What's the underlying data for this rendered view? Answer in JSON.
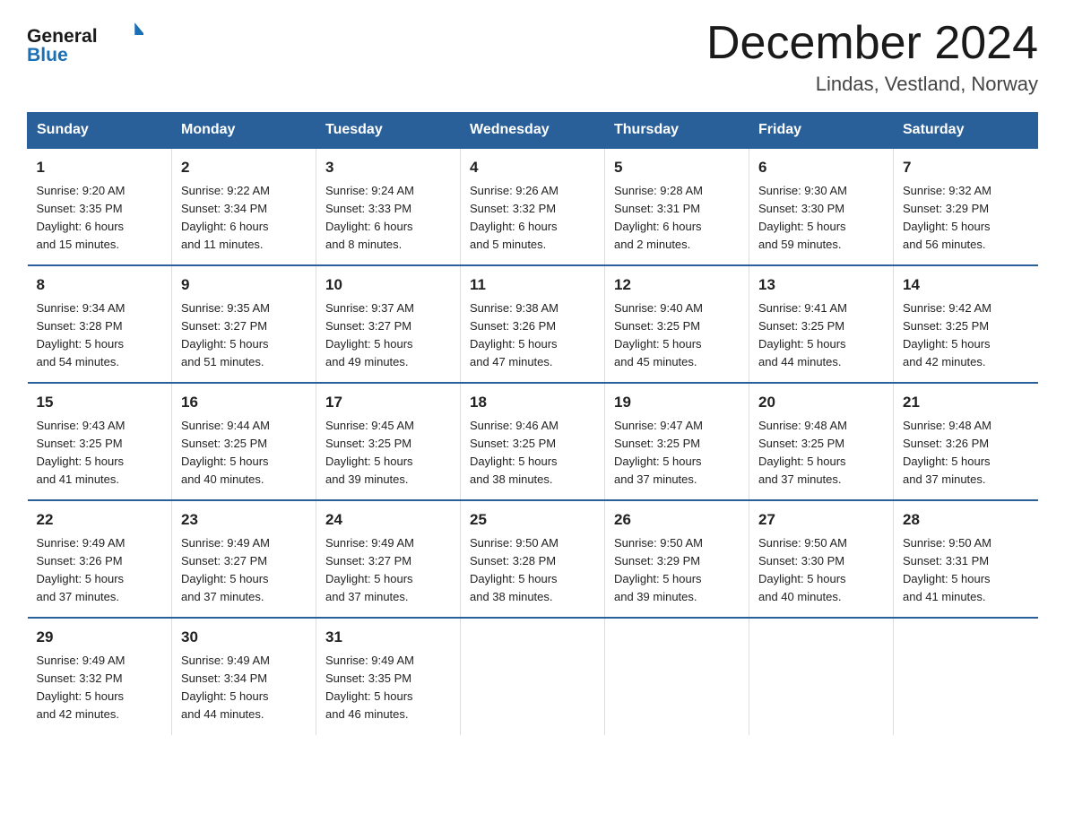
{
  "header": {
    "logo_general": "General",
    "logo_blue": "Blue",
    "month_title": "December 2024",
    "location": "Lindas, Vestland, Norway"
  },
  "weekdays": [
    "Sunday",
    "Monday",
    "Tuesday",
    "Wednesday",
    "Thursday",
    "Friday",
    "Saturday"
  ],
  "weeks": [
    [
      {
        "day": "1",
        "info": "Sunrise: 9:20 AM\nSunset: 3:35 PM\nDaylight: 6 hours\nand 15 minutes."
      },
      {
        "day": "2",
        "info": "Sunrise: 9:22 AM\nSunset: 3:34 PM\nDaylight: 6 hours\nand 11 minutes."
      },
      {
        "day": "3",
        "info": "Sunrise: 9:24 AM\nSunset: 3:33 PM\nDaylight: 6 hours\nand 8 minutes."
      },
      {
        "day": "4",
        "info": "Sunrise: 9:26 AM\nSunset: 3:32 PM\nDaylight: 6 hours\nand 5 minutes."
      },
      {
        "day": "5",
        "info": "Sunrise: 9:28 AM\nSunset: 3:31 PM\nDaylight: 6 hours\nand 2 minutes."
      },
      {
        "day": "6",
        "info": "Sunrise: 9:30 AM\nSunset: 3:30 PM\nDaylight: 5 hours\nand 59 minutes."
      },
      {
        "day": "7",
        "info": "Sunrise: 9:32 AM\nSunset: 3:29 PM\nDaylight: 5 hours\nand 56 minutes."
      }
    ],
    [
      {
        "day": "8",
        "info": "Sunrise: 9:34 AM\nSunset: 3:28 PM\nDaylight: 5 hours\nand 54 minutes."
      },
      {
        "day": "9",
        "info": "Sunrise: 9:35 AM\nSunset: 3:27 PM\nDaylight: 5 hours\nand 51 minutes."
      },
      {
        "day": "10",
        "info": "Sunrise: 9:37 AM\nSunset: 3:27 PM\nDaylight: 5 hours\nand 49 minutes."
      },
      {
        "day": "11",
        "info": "Sunrise: 9:38 AM\nSunset: 3:26 PM\nDaylight: 5 hours\nand 47 minutes."
      },
      {
        "day": "12",
        "info": "Sunrise: 9:40 AM\nSunset: 3:25 PM\nDaylight: 5 hours\nand 45 minutes."
      },
      {
        "day": "13",
        "info": "Sunrise: 9:41 AM\nSunset: 3:25 PM\nDaylight: 5 hours\nand 44 minutes."
      },
      {
        "day": "14",
        "info": "Sunrise: 9:42 AM\nSunset: 3:25 PM\nDaylight: 5 hours\nand 42 minutes."
      }
    ],
    [
      {
        "day": "15",
        "info": "Sunrise: 9:43 AM\nSunset: 3:25 PM\nDaylight: 5 hours\nand 41 minutes."
      },
      {
        "day": "16",
        "info": "Sunrise: 9:44 AM\nSunset: 3:25 PM\nDaylight: 5 hours\nand 40 minutes."
      },
      {
        "day": "17",
        "info": "Sunrise: 9:45 AM\nSunset: 3:25 PM\nDaylight: 5 hours\nand 39 minutes."
      },
      {
        "day": "18",
        "info": "Sunrise: 9:46 AM\nSunset: 3:25 PM\nDaylight: 5 hours\nand 38 minutes."
      },
      {
        "day": "19",
        "info": "Sunrise: 9:47 AM\nSunset: 3:25 PM\nDaylight: 5 hours\nand 37 minutes."
      },
      {
        "day": "20",
        "info": "Sunrise: 9:48 AM\nSunset: 3:25 PM\nDaylight: 5 hours\nand 37 minutes."
      },
      {
        "day": "21",
        "info": "Sunrise: 9:48 AM\nSunset: 3:26 PM\nDaylight: 5 hours\nand 37 minutes."
      }
    ],
    [
      {
        "day": "22",
        "info": "Sunrise: 9:49 AM\nSunset: 3:26 PM\nDaylight: 5 hours\nand 37 minutes."
      },
      {
        "day": "23",
        "info": "Sunrise: 9:49 AM\nSunset: 3:27 PM\nDaylight: 5 hours\nand 37 minutes."
      },
      {
        "day": "24",
        "info": "Sunrise: 9:49 AM\nSunset: 3:27 PM\nDaylight: 5 hours\nand 37 minutes."
      },
      {
        "day": "25",
        "info": "Sunrise: 9:50 AM\nSunset: 3:28 PM\nDaylight: 5 hours\nand 38 minutes."
      },
      {
        "day": "26",
        "info": "Sunrise: 9:50 AM\nSunset: 3:29 PM\nDaylight: 5 hours\nand 39 minutes."
      },
      {
        "day": "27",
        "info": "Sunrise: 9:50 AM\nSunset: 3:30 PM\nDaylight: 5 hours\nand 40 minutes."
      },
      {
        "day": "28",
        "info": "Sunrise: 9:50 AM\nSunset: 3:31 PM\nDaylight: 5 hours\nand 41 minutes."
      }
    ],
    [
      {
        "day": "29",
        "info": "Sunrise: 9:49 AM\nSunset: 3:32 PM\nDaylight: 5 hours\nand 42 minutes."
      },
      {
        "day": "30",
        "info": "Sunrise: 9:49 AM\nSunset: 3:34 PM\nDaylight: 5 hours\nand 44 minutes."
      },
      {
        "day": "31",
        "info": "Sunrise: 9:49 AM\nSunset: 3:35 PM\nDaylight: 5 hours\nand 46 minutes."
      },
      {
        "day": "",
        "info": ""
      },
      {
        "day": "",
        "info": ""
      },
      {
        "day": "",
        "info": ""
      },
      {
        "day": "",
        "info": ""
      }
    ]
  ]
}
